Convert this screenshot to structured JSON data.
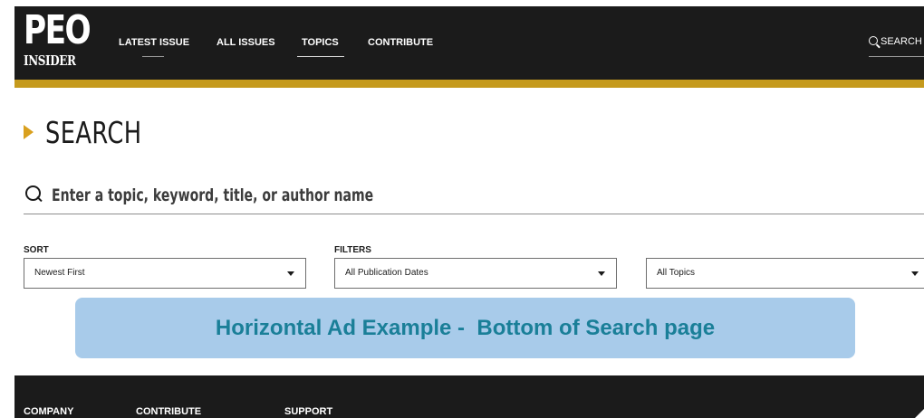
{
  "header": {
    "logo": {
      "line1": "PEO",
      "line2": "INSIDER"
    },
    "nav": [
      {
        "label": "LATEST ISSUE",
        "active": false
      },
      {
        "label": "ALL ISSUES",
        "active": false
      },
      {
        "label": "TOPICS",
        "active": true
      },
      {
        "label": "CONTRIBUTE",
        "active": false
      }
    ],
    "search_label": "SEARCH",
    "search_icon": "search-icon"
  },
  "main": {
    "title": "SEARCH",
    "search": {
      "placeholder": "Enter a topic, keyword, title, or author name",
      "value": ""
    },
    "sort": {
      "label": "SORT",
      "selected": "Newest First"
    },
    "filters": {
      "label": "FILTERS",
      "publication_dates": "All Publication Dates",
      "topics": "All Topics"
    }
  },
  "ad": {
    "text": "Horizontal Ad Example -  Bottom of Search page"
  },
  "footer": {
    "columns": [
      "COMPANY",
      "CONTRIBUTE",
      "SUPPORT"
    ]
  },
  "colors": {
    "header_bg": "#1b1b1b",
    "accent_gold": "#c59a1d",
    "ad_bg": "#a8cbea",
    "ad_text": "#1a7f98"
  }
}
